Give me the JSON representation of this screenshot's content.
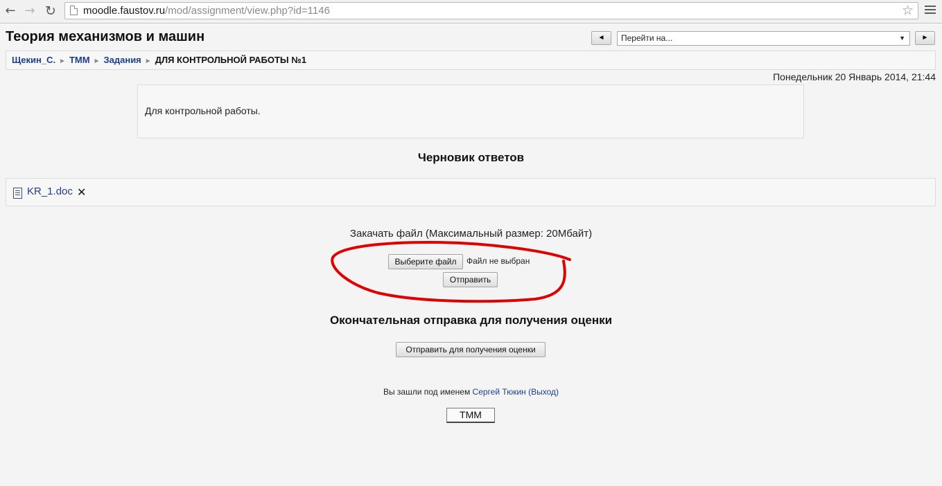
{
  "browser": {
    "url_host": "moodle.faustov.ru",
    "url_path": "/mod/assignment/view.php?id=1146"
  },
  "header": {
    "course_title": "Теория механизмов и машин",
    "jump_prev": "◄",
    "jump_next": "►",
    "jump_select": "Перейти на..."
  },
  "breadcrumb": {
    "items": [
      "Щекин_С.",
      "ТММ",
      "Задания"
    ],
    "current": "ДЛЯ КОНТРОЛЬНОЙ РАБОТЫ №1",
    "separator": "►"
  },
  "datetime": "Понедельник 20 Январь 2014, 21:44",
  "intro": {
    "text": "Для контрольной работы."
  },
  "draft": {
    "heading": "Черновик ответов",
    "files": [
      {
        "name": "KR_1.doc",
        "icon": "word-doc-icon"
      }
    ],
    "delete_icon": "close-icon"
  },
  "upload": {
    "label": "Закачать файл (Максимальный размер: 20Мбайт)",
    "choose_button": "Выберите файл",
    "no_file_text": "Файл не выбран",
    "send_button": "Отправить"
  },
  "final": {
    "heading": "Окончательная отправка для получения оценки",
    "button": "Отправить для получения оценки"
  },
  "footer": {
    "logged_in_prefix": "Вы зашли под именем",
    "user_name": "Сергей Тюкин",
    "logout": "(Выход)",
    "home_button": "ТММ"
  },
  "annotation": {
    "color": "#e00000"
  }
}
